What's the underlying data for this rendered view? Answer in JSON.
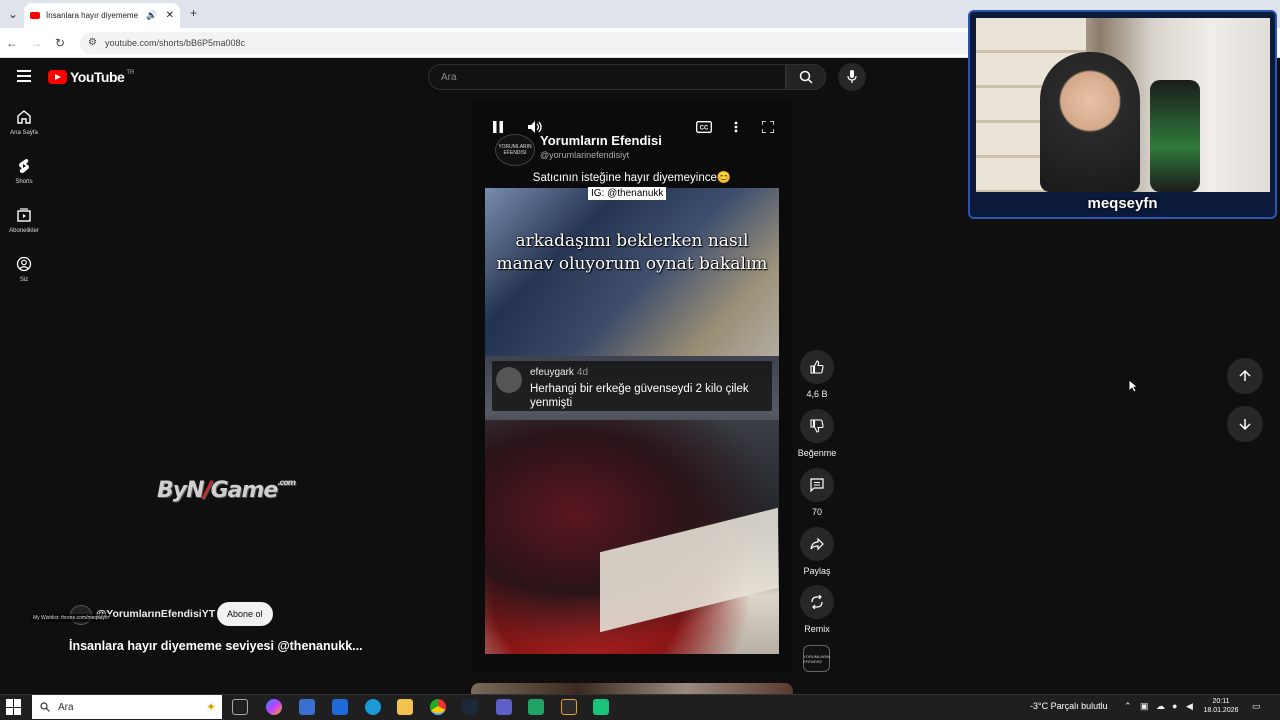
{
  "browser": {
    "tab_title": "İnsanlara hayır diyememe s",
    "url": "youtube.com/shorts/bB6P5ma008c"
  },
  "header": {
    "logo_text": "YouTube",
    "logo_country": "TR",
    "search_placeholder": "Ara"
  },
  "sidebar": {
    "items": [
      {
        "label": "Ana Sayfa",
        "icon": "home-icon"
      },
      {
        "label": "Shorts",
        "icon": "shorts-icon"
      },
      {
        "label": "Abonelikler",
        "icon": "subscriptions-icon"
      },
      {
        "label": "Siz",
        "icon": "account-icon"
      }
    ]
  },
  "video": {
    "channel_name": "Yorumların Efendisi",
    "channel_handle": "@yorumlarinefendisiyt",
    "caption": "Satıcının isteğine hayır diyemeyince😊",
    "ig_tag": "IG: @thenanukk",
    "overlay_text": "arkadaşımı beklerken nasıl manav oluyorum oynat bakalım",
    "comment": {
      "user": "efeuygark",
      "age": "4d",
      "text": "Herhangi bir erkeğe güvenseydi 2 kilo çilek yenmişti"
    },
    "avatar_text": "YORUMLARIN EFENDISI"
  },
  "actions": {
    "like_count": "4,6 B",
    "dislike_label": "Beğenme",
    "comment_count": "70",
    "share_label": "Paylaş",
    "remix_label": "Remix"
  },
  "bottom": {
    "channel": "@YorumlarınEfendisiYT",
    "subscribe": "Abone ol",
    "title": "İnsanlara hayır diyememe seviyesi @thenanukk...",
    "wishlist": "My Wishlist: throne.com/meqseyfn"
  },
  "stream_overlay": {
    "watermark_a": "ByN",
    "watermark_b": "Game",
    "watermark_small": ".com",
    "streamer_name": "meqseyfn"
  },
  "taskbar": {
    "search": "Ara",
    "weather": "-3°C  Parçalı bulutlu",
    "time": "20:11",
    "date": "18.01.2026"
  }
}
